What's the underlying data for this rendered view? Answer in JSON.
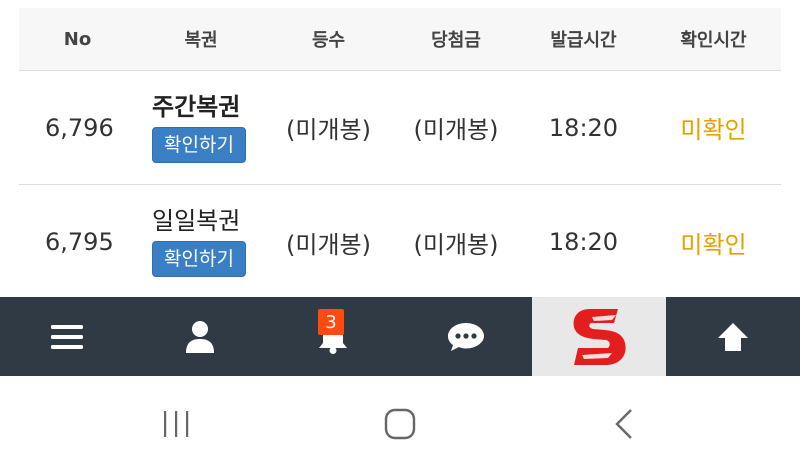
{
  "table": {
    "headers": [
      "No",
      "복권",
      "등수",
      "당첨금",
      "발급시간",
      "확인시간"
    ],
    "rows": [
      {
        "no": "6,796",
        "lotto": "주간복권",
        "button": "확인하기",
        "rank": "(미개봉)",
        "prize": "(미개봉)",
        "issued": "18:20",
        "checked": "미확인"
      },
      {
        "no": "6,795",
        "lotto": "일일복권",
        "button": "확인하기",
        "rank": "(미개봉)",
        "prize": "(미개봉)",
        "issued": "18:20",
        "checked": "미확인"
      }
    ]
  },
  "bottom_bar": {
    "items": [
      {
        "icon": "menu-icon"
      },
      {
        "icon": "user-icon"
      },
      {
        "icon": "bell-icon",
        "badge": "3"
      },
      {
        "icon": "chat-icon"
      },
      {
        "icon": "s-logo"
      },
      {
        "icon": "arrow-up-icon"
      }
    ]
  },
  "colors": {
    "button_blue": "#3a7fc4",
    "status_orange": "#e6a000",
    "bar_bg": "#2f3a45",
    "badge_red": "#ff4a10",
    "logo_red": "#e41e1e"
  },
  "android_nav": [
    "recents-icon",
    "home-icon",
    "back-icon"
  ]
}
